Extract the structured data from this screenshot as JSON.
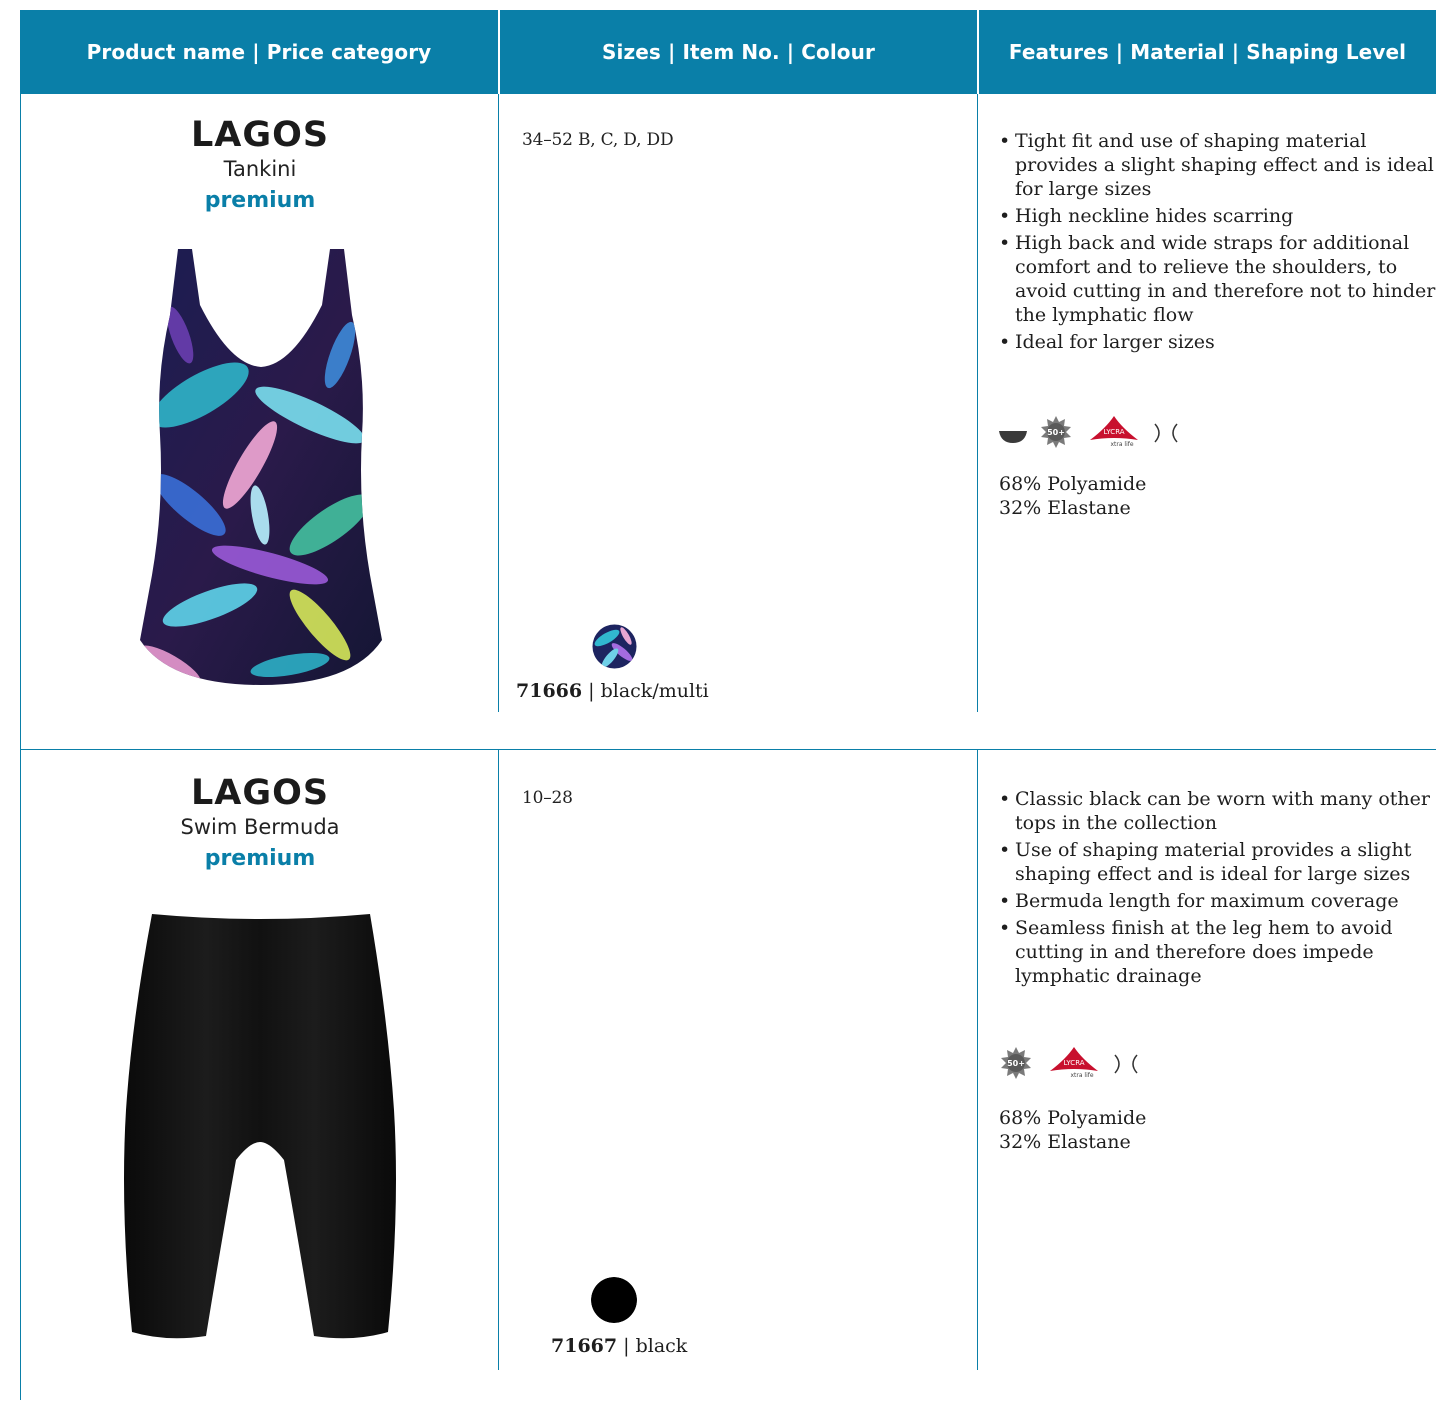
{
  "header": {
    "col1": "Product name | Price category",
    "col2": "Sizes | Item No. | Colour",
    "col3": "Features | Material  | Shaping Level"
  },
  "products": [
    {
      "name": "LAGOS",
      "type": "Tankini",
      "category": "premium",
      "sizes": "34–52 B, C, D, DD",
      "item_no": "71666",
      "colour": "black/multi",
      "features": [
        "Tight fit and use of shaping material provides a slight shaping effect and is ideal for large sizes",
        "High neckline hides scarring",
        "High back and wide straps for additional comfort and to relieve the shoulders, to avoid cutting in and therefore not to hinder the lymphatic flow",
        "Ideal for larger sizes"
      ],
      "icons": [
        "cup-icon",
        "uv-50-icon",
        "lycra-xtra-life-icon",
        "shaping-level-icon"
      ],
      "lycra_label": "LYCRA",
      "lycra_sub": "xtra life",
      "uv_label": "50+",
      "material": [
        "68% Polyamide",
        "32% Elastane"
      ]
    },
    {
      "name": "LAGOS",
      "type": "Swim Bermuda",
      "category": "premium",
      "sizes": "10–28",
      "item_no": "71667",
      "colour": "black",
      "features": [
        "Classic black can be worn with many other tops in the collection",
        "Use of shaping material provides a slight shaping effect and is ideal for large sizes",
        "Bermuda length for maximum coverage",
        "Seamless finish at the leg hem to avoid cutting in and therefore does impede lymphatic drainage"
      ],
      "icons": [
        "uv-50-icon",
        "lycra-xtra-life-icon",
        "shaping-level-icon"
      ],
      "lycra_label": "LYCRA",
      "lycra_sub": "xtra life",
      "uv_label": "50+",
      "material": [
        "68% Polyamide",
        "32% Elastane"
      ]
    }
  ],
  "colors": {
    "accent": "#0a7fa8",
    "lycra_red": "#c8102e",
    "swatch_black": "#000000"
  }
}
